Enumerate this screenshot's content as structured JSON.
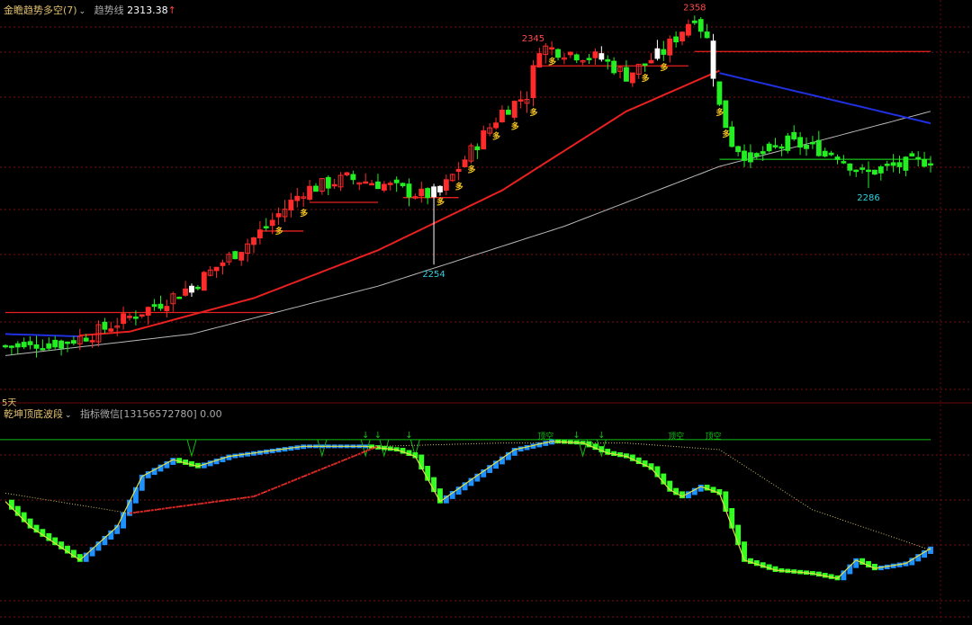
{
  "header_top": {
    "indicator_name": "金瞻趋势多空(7)",
    "trend_label": "趋势线",
    "trend_value": "2313.38",
    "trend_arrow": "↑"
  },
  "header_bottom": {
    "indicator_name": "乾坤顶底波段",
    "info_text": "指标微信[13156572780]",
    "info_value": "0.00"
  },
  "period_label": "5天",
  "colors": {
    "up": "#ff2a2a",
    "down": "#22ee22",
    "flat": "#ffffff",
    "ma_red": "#e82020",
    "ma_gray": "#b8b8b8",
    "ma_blue": "#2030e0",
    "grid": "#7a1010",
    "label_red": "#ff4a4a",
    "label_cyan": "#30d0e0",
    "duo": "#f0c020",
    "osc_green": "#33ff22",
    "osc_blue": "#1e90ff",
    "osc_yellow": "#e0e040",
    "top_green": "#11bb11"
  },
  "chart_data": [
    {
      "type": "candlestick",
      "y_range": [
        2200,
        2360
      ],
      "n_bars": 150,
      "price_labels": [
        {
          "text": "2358",
          "bar": 111,
          "price": 2358,
          "pos": "above"
        },
        {
          "text": "2345",
          "bar": 85,
          "price": 2345,
          "pos": "above"
        },
        {
          "text": "2254",
          "bar": 69,
          "price": 2254,
          "pos": "below"
        },
        {
          "text": "2286",
          "bar": 139,
          "price": 2286,
          "pos": "below"
        }
      ],
      "buy_marker_text": "多",
      "buy_marker_bars": [
        44,
        48,
        70,
        73,
        75,
        79,
        82,
        85,
        88,
        103,
        106,
        115,
        116
      ],
      "anchor_points": [
        [
          0,
          2220
        ],
        [
          10,
          2222
        ],
        [
          14,
          2225
        ],
        [
          25,
          2238
        ],
        [
          30,
          2245
        ],
        [
          40,
          2265
        ],
        [
          48,
          2285
        ],
        [
          55,
          2290
        ],
        [
          60,
          2288
        ],
        [
          67,
          2283
        ],
        [
          70,
          2284
        ],
        [
          74,
          2298
        ],
        [
          80,
          2318
        ],
        [
          84,
          2325
        ],
        [
          86,
          2345
        ],
        [
          96,
          2340
        ],
        [
          100,
          2333
        ],
        [
          106,
          2343
        ],
        [
          111,
          2358
        ],
        [
          112,
          2353
        ],
        [
          113,
          2348
        ],
        [
          115,
          2320
        ],
        [
          117,
          2305
        ],
        [
          120,
          2298
        ],
        [
          126,
          2305
        ],
        [
          130,
          2303
        ],
        [
          134,
          2300
        ],
        [
          138,
          2292
        ],
        [
          141,
          2294
        ],
        [
          149,
          2298
        ]
      ],
      "red_ma": [
        [
          0,
          2222
        ],
        [
          20,
          2226
        ],
        [
          40,
          2240
        ],
        [
          60,
          2260
        ],
        [
          80,
          2285
        ],
        [
          100,
          2318
        ],
        [
          115,
          2335
        ],
        [
          120,
          2332
        ],
        [
          149,
          2313
        ]
      ],
      "gray_ma": [
        [
          0,
          2216
        ],
        [
          30,
          2225
        ],
        [
          60,
          2245
        ],
        [
          90,
          2270
        ],
        [
          115,
          2295
        ],
        [
          130,
          2305
        ],
        [
          149,
          2318
        ]
      ],
      "blue_trend": [
        [
          0,
          2225
        ],
        [
          12,
          2224
        ],
        [
          115,
          2334
        ],
        [
          149,
          2313
        ]
      ],
      "resistance_lines": [
        {
          "price": 2234,
          "bar_from": 0,
          "bar_to": 43
        },
        {
          "price": 2268,
          "bar_from": 41,
          "bar_to": 48
        },
        {
          "price": 2280,
          "bar_from": 49,
          "bar_to": 60
        },
        {
          "price": 2282,
          "bar_from": 64,
          "bar_to": 73
        },
        {
          "price": 2337,
          "bar_from": 85,
          "bar_to": 110
        },
        {
          "price": 2343,
          "bar_from": 111,
          "bar_to": 149
        }
      ],
      "support_line": {
        "price": 2298,
        "bar_from": 115,
        "bar_to": 149
      }
    },
    {
      "type": "oscillator",
      "y_range": [
        0,
        100
      ],
      "top_line_value": 92,
      "top_signal_text": "顶空",
      "top_signal_bars": [
        87,
        108,
        114
      ],
      "dip_markers": [
        30,
        51,
        58,
        61,
        66,
        93,
        96
      ],
      "arrow_bars": [
        58,
        60,
        65,
        92,
        96
      ],
      "anchor_points": [
        [
          0,
          55
        ],
        [
          4,
          40
        ],
        [
          8,
          30
        ],
        [
          12,
          20
        ],
        [
          18,
          40
        ],
        [
          22,
          70
        ],
        [
          27,
          80
        ],
        [
          31,
          76
        ],
        [
          36,
          82
        ],
        [
          48,
          88
        ],
        [
          58,
          88
        ],
        [
          63,
          86
        ],
        [
          66,
          82
        ],
        [
          70,
          55
        ],
        [
          75,
          68
        ],
        [
          82,
          86
        ],
        [
          88,
          91
        ],
        [
          93,
          90
        ],
        [
          97,
          84
        ],
        [
          100,
          82
        ],
        [
          104,
          75
        ],
        [
          107,
          62
        ],
        [
          109,
          58
        ],
        [
          112,
          64
        ],
        [
          115,
          60
        ],
        [
          117,
          40
        ],
        [
          119,
          20
        ],
        [
          124,
          14
        ],
        [
          130,
          12
        ],
        [
          134,
          9
        ],
        [
          137,
          20
        ],
        [
          140,
          15
        ],
        [
          145,
          18
        ],
        [
          149,
          27
        ]
      ],
      "signal_line": [
        [
          0,
          60
        ],
        [
          20,
          48
        ],
        [
          40,
          58
        ],
        [
          60,
          88
        ],
        [
          80,
          90
        ],
        [
          100,
          90
        ],
        [
          115,
          86
        ],
        [
          130,
          50
        ],
        [
          149,
          26
        ]
      ]
    }
  ]
}
